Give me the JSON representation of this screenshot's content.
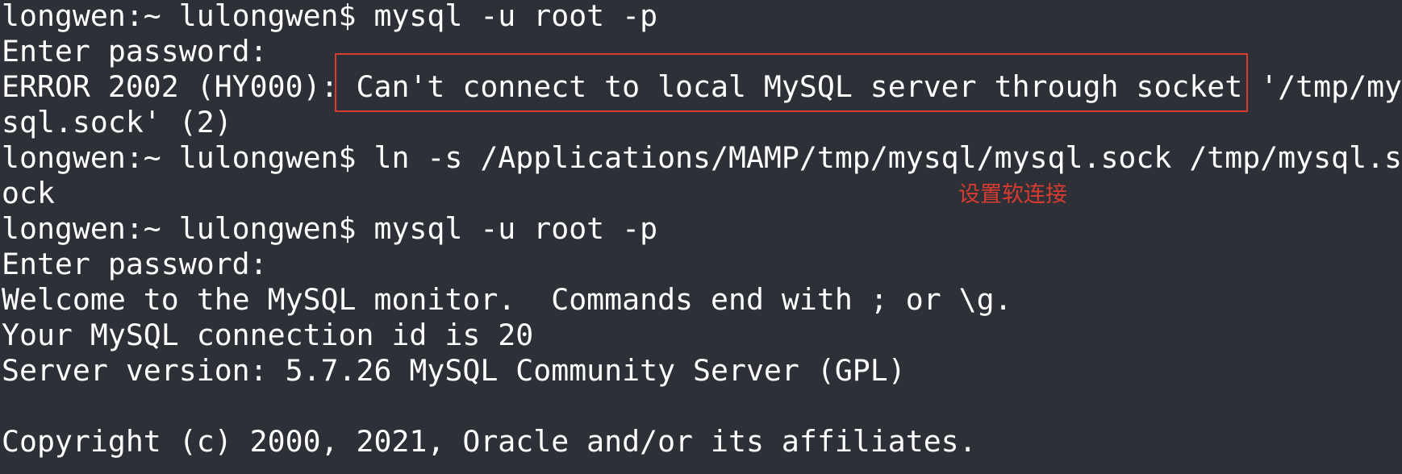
{
  "terminal": {
    "background": "#2e3038",
    "text_color": "#ffffff",
    "lines": [
      "longwen:~ lulongwen$ mysql -u root -p",
      "Enter password:",
      "ERROR 2002 (HY000): Can't connect to local MySQL server through socket '/tmp/my",
      "sql.sock' (2)",
      "longwen:~ lulongwen$ ln -s /Applications/MAMP/tmp/mysql/mysql.sock /tmp/mysql.s",
      "ock",
      "longwen:~ lulongwen$ mysql -u root -p",
      "Enter password:",
      "Welcome to the MySQL monitor.  Commands end with ; or \\g.",
      "Your MySQL connection id is 20",
      "Server version: 5.7.26 MySQL Community Server (GPL)",
      "",
      "Copyright (c) 2000, 2021, Oracle and/or its affiliates."
    ]
  },
  "annotation": {
    "text": "设置软连接",
    "color": "#d83b2f"
  },
  "highlight": {
    "border_color": "#d83b2f"
  }
}
